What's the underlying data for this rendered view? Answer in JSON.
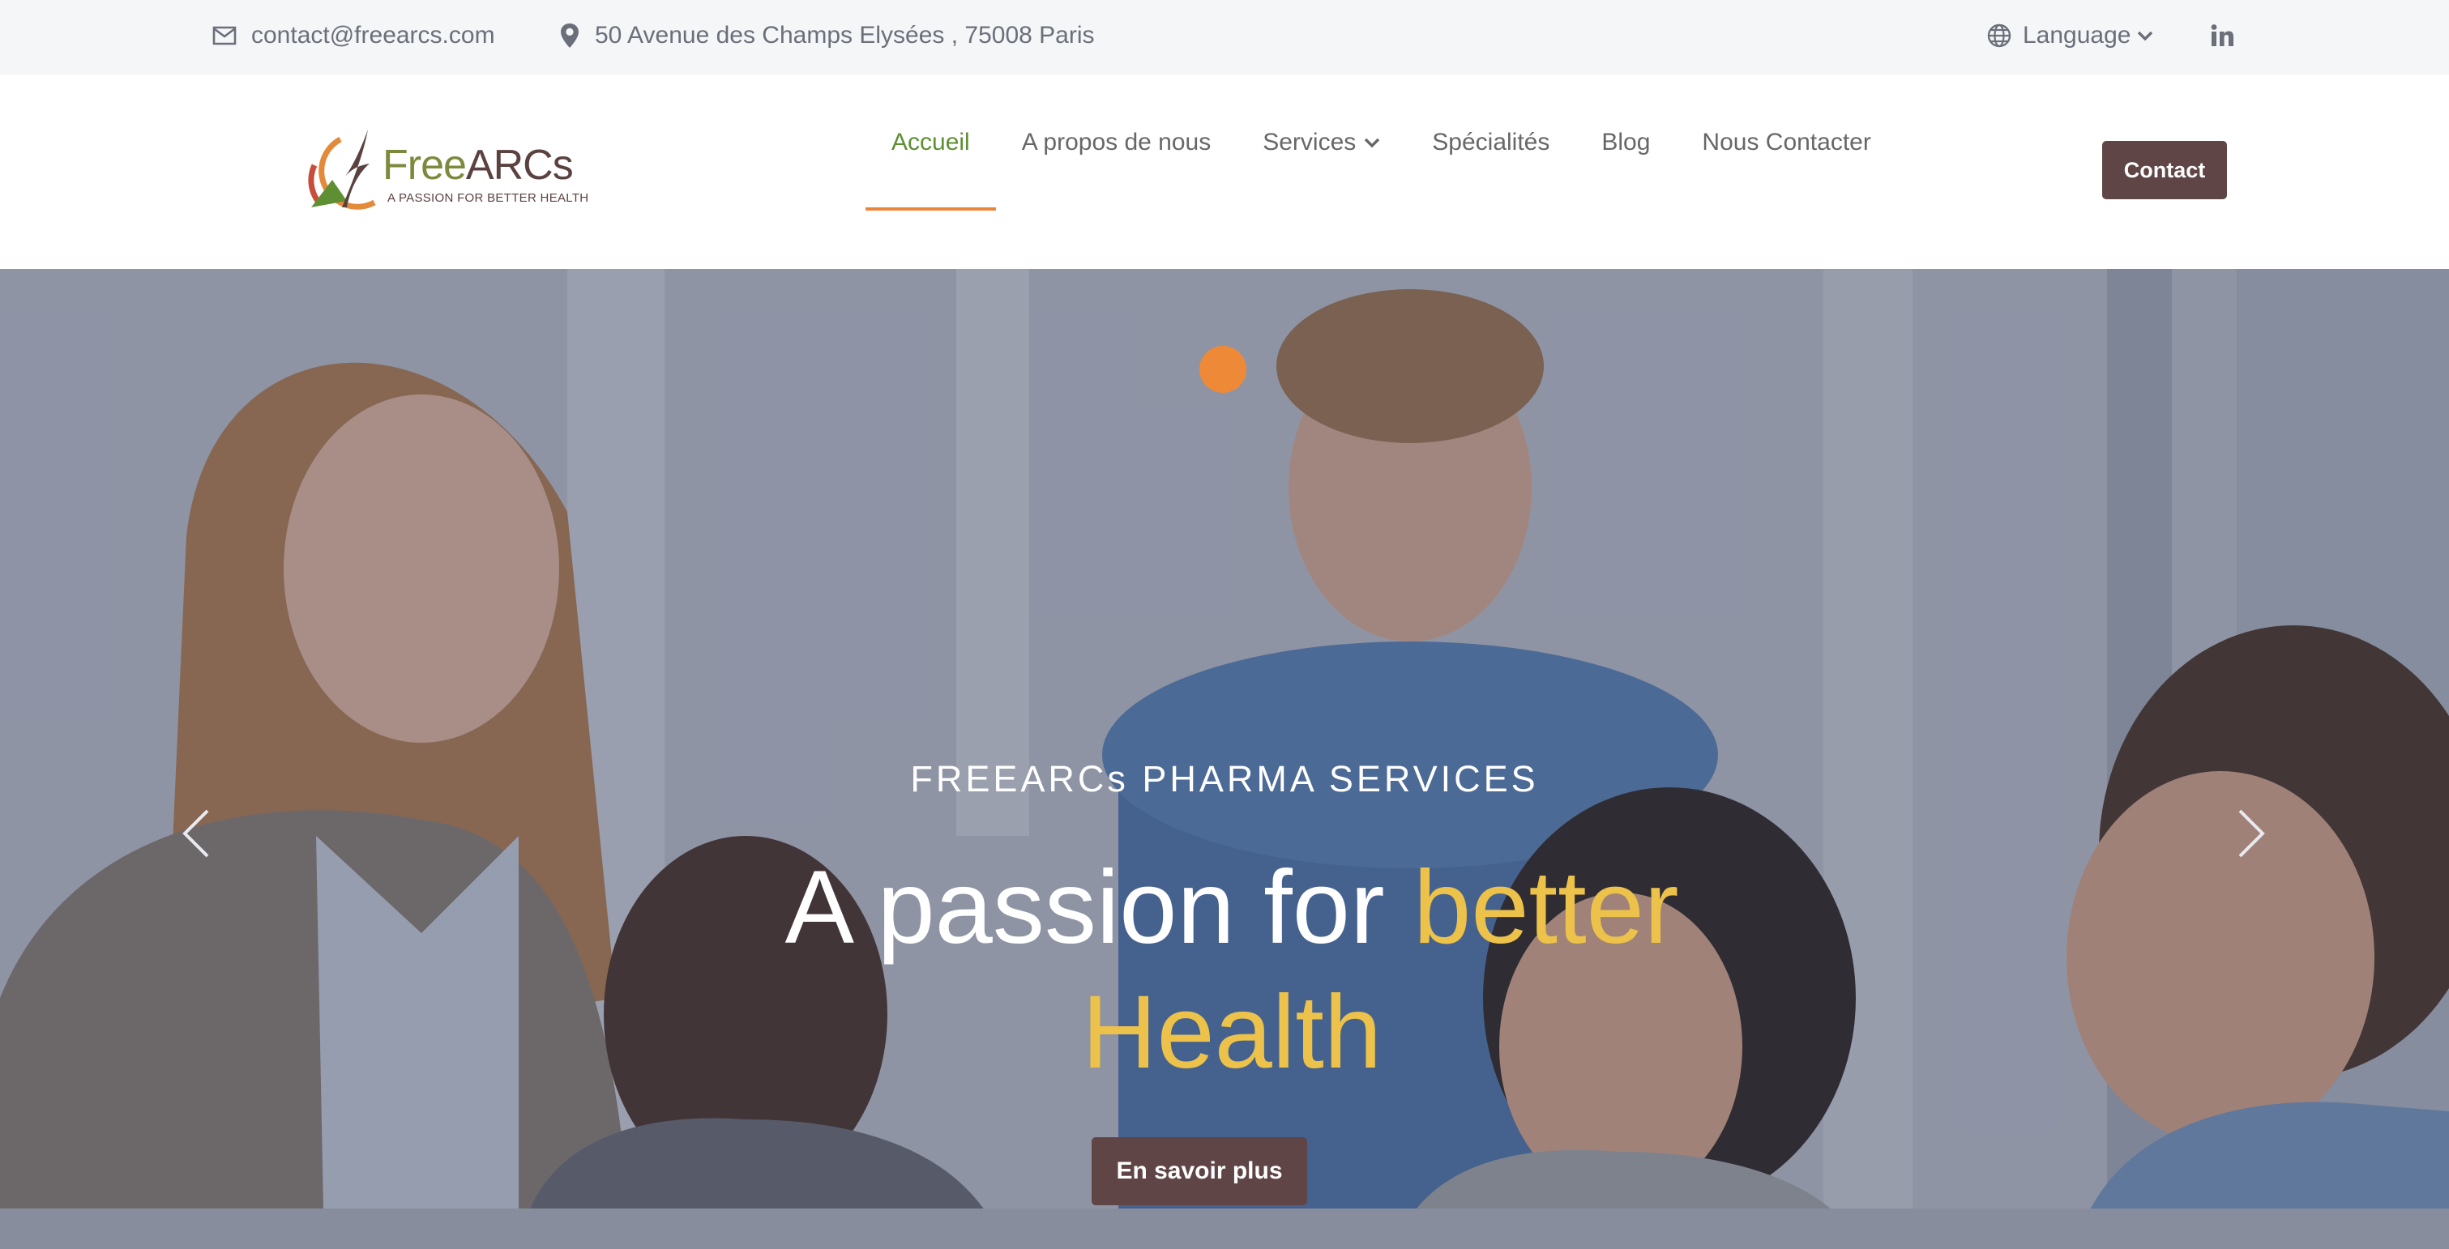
{
  "topbar": {
    "email": "contact@freearcs.com",
    "address": "50 Avenue des Champs Elysées , 75008 Paris",
    "language_label": "Language"
  },
  "logo": {
    "name_part1": "Free",
    "name_part2": "ARCs",
    "tagline": "A PASSION FOR BETTER HEALTH"
  },
  "nav": {
    "items": [
      {
        "label": "Accueil"
      },
      {
        "label": "A propos de nous"
      },
      {
        "label": "Services"
      },
      {
        "label": "Spécialités"
      },
      {
        "label": "Blog"
      },
      {
        "label": "Nous Contacter"
      }
    ],
    "active_index": 0,
    "contact_button": "Contact"
  },
  "hero": {
    "kicker": "FREEARCs PHARMA SERVICES",
    "title_plain": "A passion for ",
    "title_accent_1": "better",
    "title_accent_2": "Health",
    "cta": "En savoir plus"
  },
  "colors": {
    "active_nav": "#5e8f33",
    "active_underline": "#e9863a",
    "button_bg": "#5f4546",
    "accent_text": "#ecc24a",
    "slider_dot": "#ee8a37",
    "topbar_bg": "#f5f6f8"
  },
  "icons": {
    "email": "envelope-icon",
    "address": "map-pin-icon",
    "language": "globe-icon",
    "social": "linkedin-icon",
    "prev": "chevron-left-icon",
    "next": "chevron-right-icon"
  }
}
